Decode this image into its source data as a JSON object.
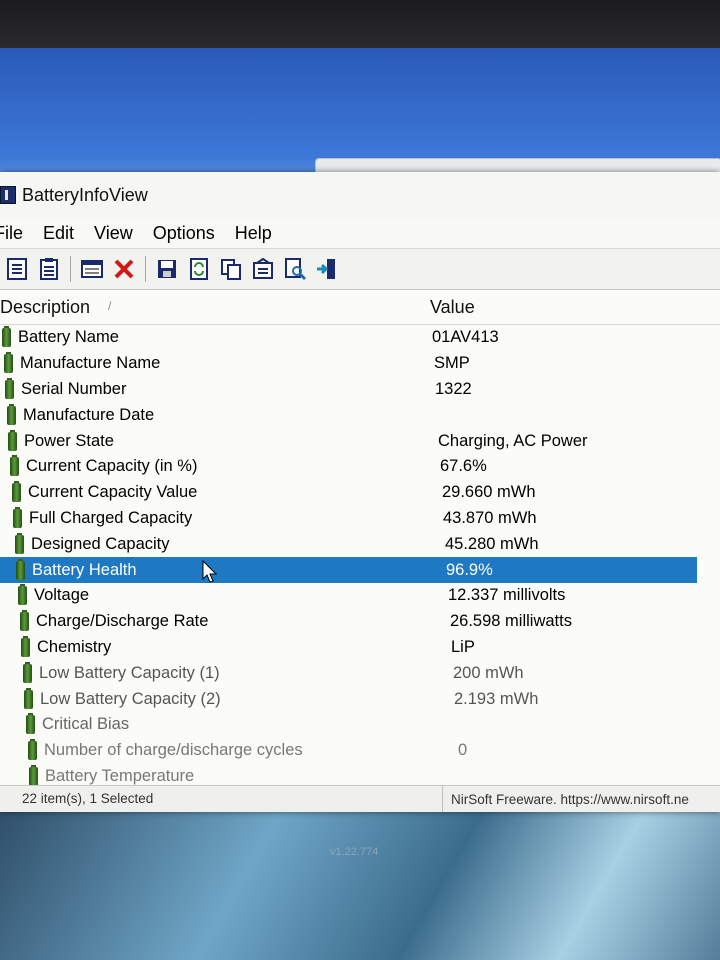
{
  "window": {
    "title": "BatteryInfoView"
  },
  "menu": [
    "File",
    "Edit",
    "View",
    "Options",
    "Help"
  ],
  "toolbar": [
    "html-report-icon",
    "report-icon",
    "properties-icon",
    "delete-icon",
    "save-icon",
    "refresh-icon",
    "copy-icon",
    "options-icon",
    "find-icon",
    "exit-icon"
  ],
  "columns": {
    "description": "Description",
    "value": "Value"
  },
  "rows": [
    {
      "description": "Battery Name",
      "value": "01AV413"
    },
    {
      "description": "Manufacture Name",
      "value": "SMP"
    },
    {
      "description": "Serial Number",
      "value": "1322"
    },
    {
      "description": "Manufacture Date",
      "value": ""
    },
    {
      "description": "Power State",
      "value": "Charging, AC Power"
    },
    {
      "description": "Current Capacity (in %)",
      "value": "67.6%"
    },
    {
      "description": "Current Capacity Value",
      "value": "29.660 mWh"
    },
    {
      "description": "Full Charged Capacity",
      "value": "43.870 mWh"
    },
    {
      "description": "Designed Capacity",
      "value": "45.280 mWh"
    },
    {
      "description": "Battery Health",
      "value": "96.9%",
      "selected": true
    },
    {
      "description": "Voltage",
      "value": "12.337 millivolts"
    },
    {
      "description": "Charge/Discharge Rate",
      "value": "26.598 milliwatts"
    },
    {
      "description": "Chemistry",
      "value": "LiP"
    },
    {
      "description": "Low Battery Capacity (1)",
      "value": "200 mWh"
    },
    {
      "description": "Low Battery Capacity (2)",
      "value": "2.193 mWh"
    },
    {
      "description": "Critical Bias",
      "value": ""
    },
    {
      "description": "Number of charge/discharge cycles",
      "value": "0"
    },
    {
      "description": "Battery Temperature",
      "value": ""
    }
  ],
  "status": {
    "items": "22 item(s), 1 Selected",
    "credit": "NirSoft Freeware. https://www.nirsoft.ne"
  },
  "desktop": {
    "version_text": "v1.22.774"
  },
  "colors": {
    "selection": "#1e78c2",
    "battery_icon": "#4a8a2a"
  }
}
